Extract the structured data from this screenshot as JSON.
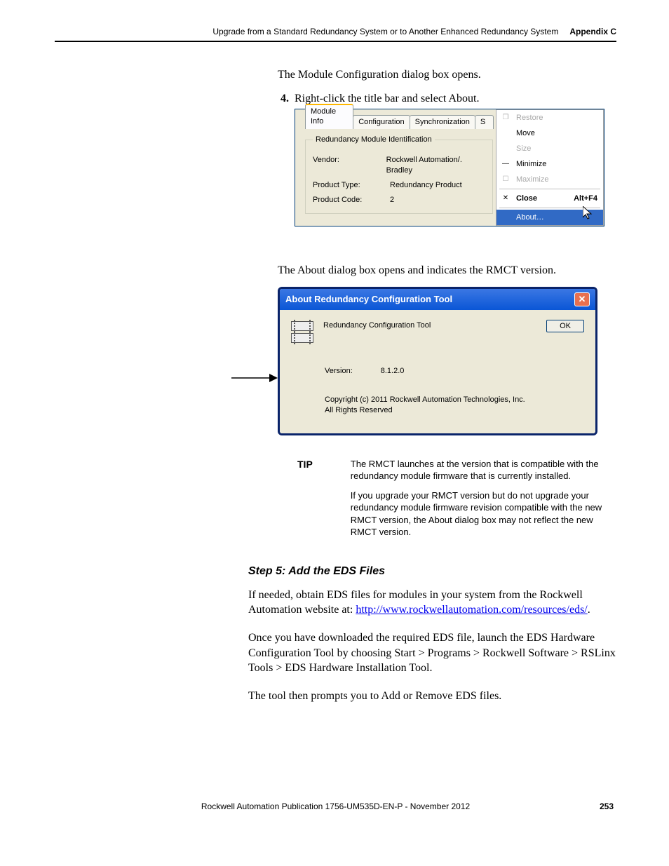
{
  "header": {
    "chapter": "Upgrade from a Standard Redundancy System or to Another Enhanced Redundancy System",
    "appendix": "Appendix C"
  },
  "intro1": "The Module Configuration dialog box opens.",
  "step_num": "4.",
  "step_text": "Right-click the title bar and select About.",
  "shot1": {
    "tabs": {
      "t1": "Module Info",
      "t2": "Configuration",
      "t3": "Synchronization",
      "t4": "S"
    },
    "fieldset_legend": "Redundancy Module Identification",
    "vendor_k": "Vendor:",
    "vendor_v": "Rockwell Automation/. Bradley",
    "ptype_k": "Product Type:",
    "ptype_v": "Redundancy Product",
    "pcode_k": "Product Code:",
    "pcode_v": "2",
    "menu": {
      "restore": "Restore",
      "move": "Move",
      "size": "Size",
      "minimize": "Minimize",
      "maximize": "Maximize",
      "close": "Close",
      "close_short": "Alt+F4",
      "about": "About…"
    }
  },
  "intro2": "The About dialog box opens and indicates the RMCT version.",
  "shot2": {
    "title": "About Redundancy Configuration Tool",
    "name": "Redundancy Configuration Tool",
    "ok": "OK",
    "ver_k": "Version:",
    "ver_v": "8.1.2.0",
    "copy1": "Copyright (c) 2011 Rockwell Automation Technologies, Inc.",
    "copy2": "All Rights Reserved"
  },
  "tip": {
    "label": "TIP",
    "p1": "The RMCT launches at the version that is compatible with the redundancy module firmware that is currently installed.",
    "p2": "If you upgrade your RMCT version but do not upgrade your redundancy module firmware revision compatible with the new RMCT version, the About dialog box may not reflect the new RMCT version."
  },
  "step5_h": "Step 5: Add the EDS Files",
  "p_eds1a": "If needed, obtain EDS files for modules in your system from the Rockwell Automation website at: ",
  "p_eds1_link": "http://www.rockwellautomation.com/resources/eds/",
  "p_eds1b": ".",
  "p_eds2": "Once you have downloaded the required EDS file, launch the EDS Hardware Configuration Tool by choosing Start > Programs > Rockwell Software > RSLinx Tools > EDS Hardware Installation Tool.",
  "p_eds3": "The tool then prompts you to Add or Remove EDS files.",
  "footer": {
    "pub": "Rockwell Automation Publication 1756-UM535D-EN-P - November 2012",
    "page": "253"
  }
}
